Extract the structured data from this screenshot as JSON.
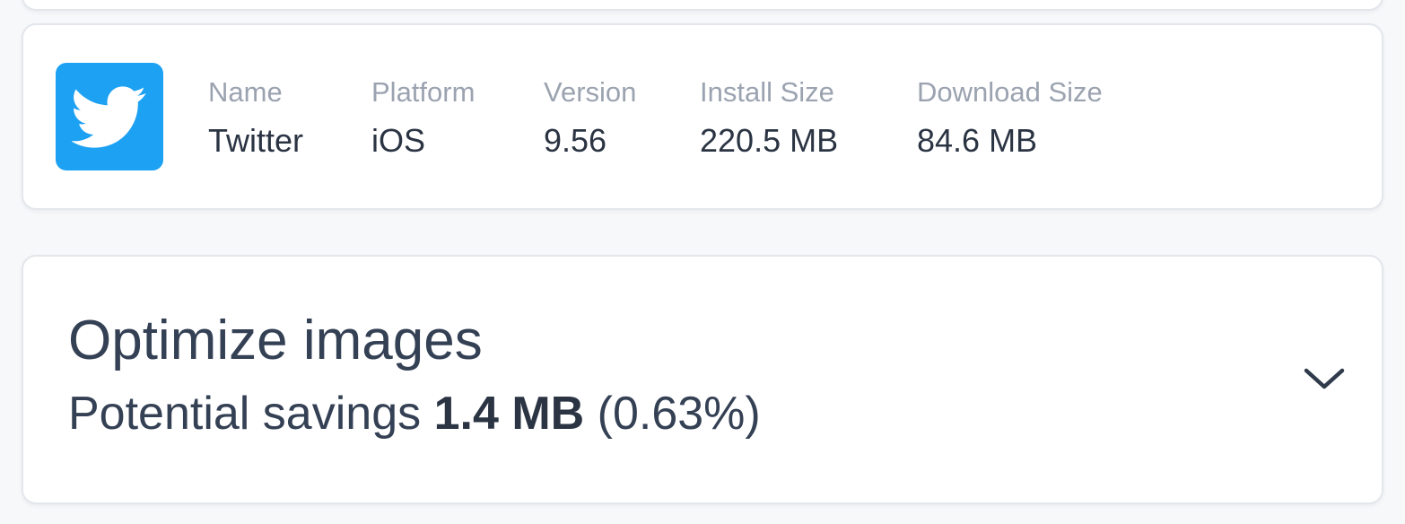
{
  "app": {
    "icon": "twitter-bird-icon",
    "icon_bg": "#1da1f2",
    "fields": {
      "name": {
        "label": "Name",
        "value": "Twitter"
      },
      "platform": {
        "label": "Platform",
        "value": "iOS"
      },
      "version": {
        "label": "Version",
        "value": "9.56"
      },
      "install_size": {
        "label": "Install Size",
        "value": "220.5 MB"
      },
      "download_size": {
        "label": "Download Size",
        "value": "84.6 MB"
      }
    }
  },
  "insight": {
    "title": "Optimize images",
    "savings_prefix": "Potential savings ",
    "savings_amount": "1.4 MB",
    "savings_percent": " (0.63%)",
    "toggle_icon": "chevron-down-icon"
  },
  "colors": {
    "accent": "#1da1f2",
    "label": "#9ba3b0",
    "text": "#2b3443"
  }
}
